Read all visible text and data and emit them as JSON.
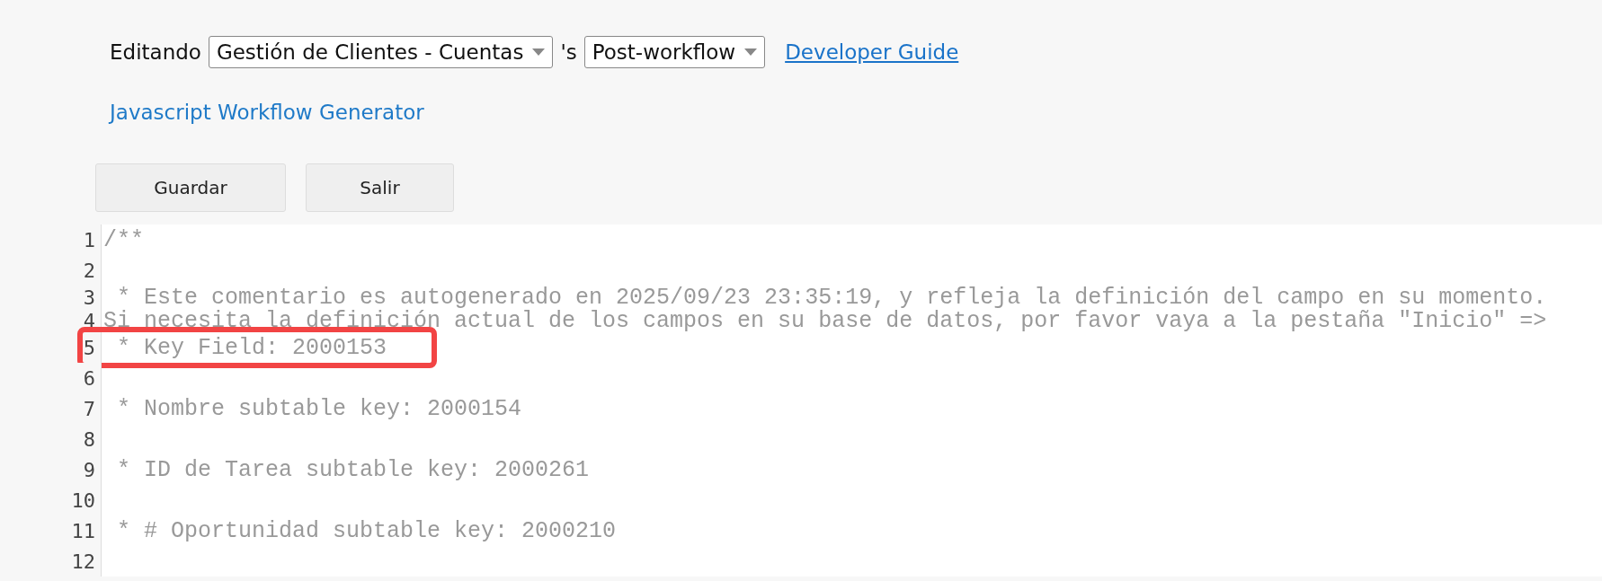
{
  "header": {
    "label": "Editando",
    "form_select": "Gestión de Clientes - Cuentas",
    "separator": "'s",
    "workflow_select": "Post-workflow",
    "guide_link": "Developer Guide"
  },
  "generator_link": "Javascript Workflow Generator",
  "buttons": [
    "Guardar",
    "Salir"
  ],
  "editor": {
    "lines": [
      {
        "number": "1",
        "text": "/**",
        "highlighted": false
      },
      {
        "number": "2",
        "highlighted": false
      },
      {
        "number": "3",
        "text": " * Este comentario es autogenerado en 2025/09/23 23:35:19, y refleja la definición del campo en su momento.",
        "highlighted": false
      },
      {
        "number": "4",
        "text": "Si necesita la definición actual de los campos en su base de datos, por favor vaya a la pestaña \"Inicio\" =>",
        "highlighted": false
      },
      {
        "number": "5",
        "text": " * Key Field: 2000153",
        "highlighted": true
      },
      {
        "number": "6",
        "highlighted": false
      },
      {
        "number": "7",
        "text": " * Nombre subtable key: 2000154",
        "highlighted": false
      },
      {
        "number": "8",
        "highlighted": false
      },
      {
        "number": "9",
        "text": " * ID de Tarea subtable key: 2000261",
        "highlighted": false
      },
      {
        "number": "10",
        "highlighted": false
      },
      {
        "number": "11",
        "text": " * # Oportunidad subtable key: 2000210",
        "highlighted": false
      },
      {
        "number": "12",
        "highlighted": false
      }
    ]
  }
}
